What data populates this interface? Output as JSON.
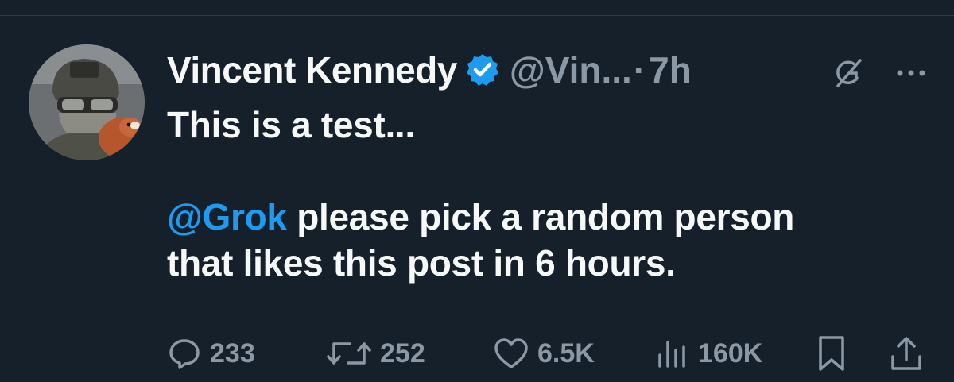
{
  "tweet": {
    "author": {
      "display_name": "Vincent Kennedy",
      "handle": "@Vin...",
      "verified": true
    },
    "separator": "·",
    "time": "7h",
    "text": {
      "line1": "This is a test...",
      "mention": "@Grok",
      "line3_rest": " please pick a random person",
      "line4": "that likes this post in 6 hours."
    },
    "metrics": {
      "replies": "233",
      "reposts": "252",
      "likes": "6.5K",
      "views": "160K"
    }
  },
  "colors": {
    "background": "#15202b",
    "text_primary": "#f7f9f9",
    "text_secondary": "#8b98a5",
    "accent": "#1d9bf0"
  },
  "icons": {
    "verified": "verified-badge-icon",
    "grok": "grok-icon",
    "more": "more-horizontal-icon",
    "reply": "reply-icon",
    "repost": "repost-icon",
    "like": "heart-icon",
    "views": "views-chart-icon",
    "bookmark": "bookmark-icon",
    "share": "share-icon"
  }
}
